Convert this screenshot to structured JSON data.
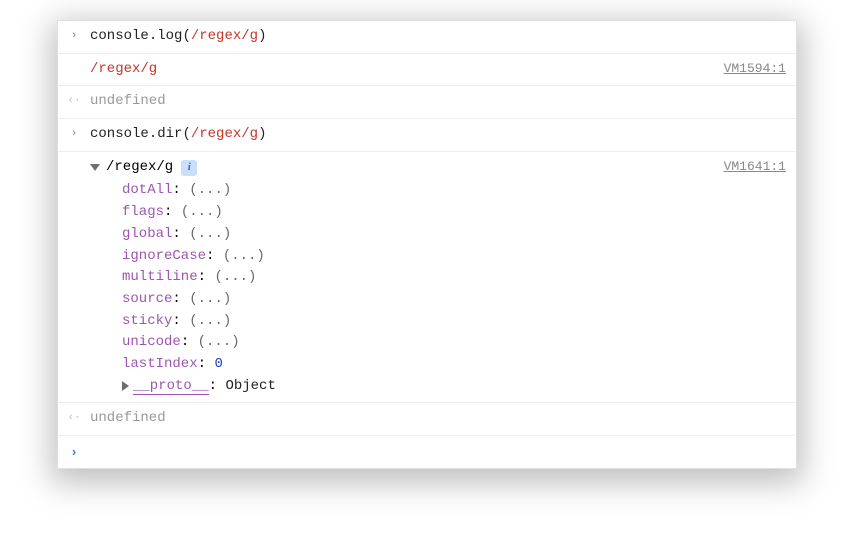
{
  "entries": {
    "input1": {
      "prefix": "console",
      "method": "log",
      "arg_regex": "/regex/g",
      "source": "VM1594:1"
    },
    "output1": {
      "regex": "/regex/g"
    },
    "return1": "undefined",
    "input2": {
      "prefix": "console",
      "method": "dir",
      "arg_regex": "/regex/g",
      "source": "VM1641:1"
    },
    "dir": {
      "header": "/regex/g",
      "props": [
        {
          "name": "dotAll",
          "value": "(...)"
        },
        {
          "name": "flags",
          "value": "(...)"
        },
        {
          "name": "global",
          "value": "(...)"
        },
        {
          "name": "ignoreCase",
          "value": "(...)"
        },
        {
          "name": "multiline",
          "value": "(...)"
        },
        {
          "name": "source",
          "value": "(...)"
        },
        {
          "name": "sticky",
          "value": "(...)"
        },
        {
          "name": "unicode",
          "value": "(...)"
        }
      ],
      "lastIndex": {
        "name": "lastIndex",
        "value": "0"
      },
      "proto": {
        "name": "__proto__",
        "value": "Object"
      }
    },
    "return2": "undefined"
  },
  "glyphs": {
    "input": "›",
    "return": "‹·",
    "prompt": "›",
    "info": "i"
  }
}
